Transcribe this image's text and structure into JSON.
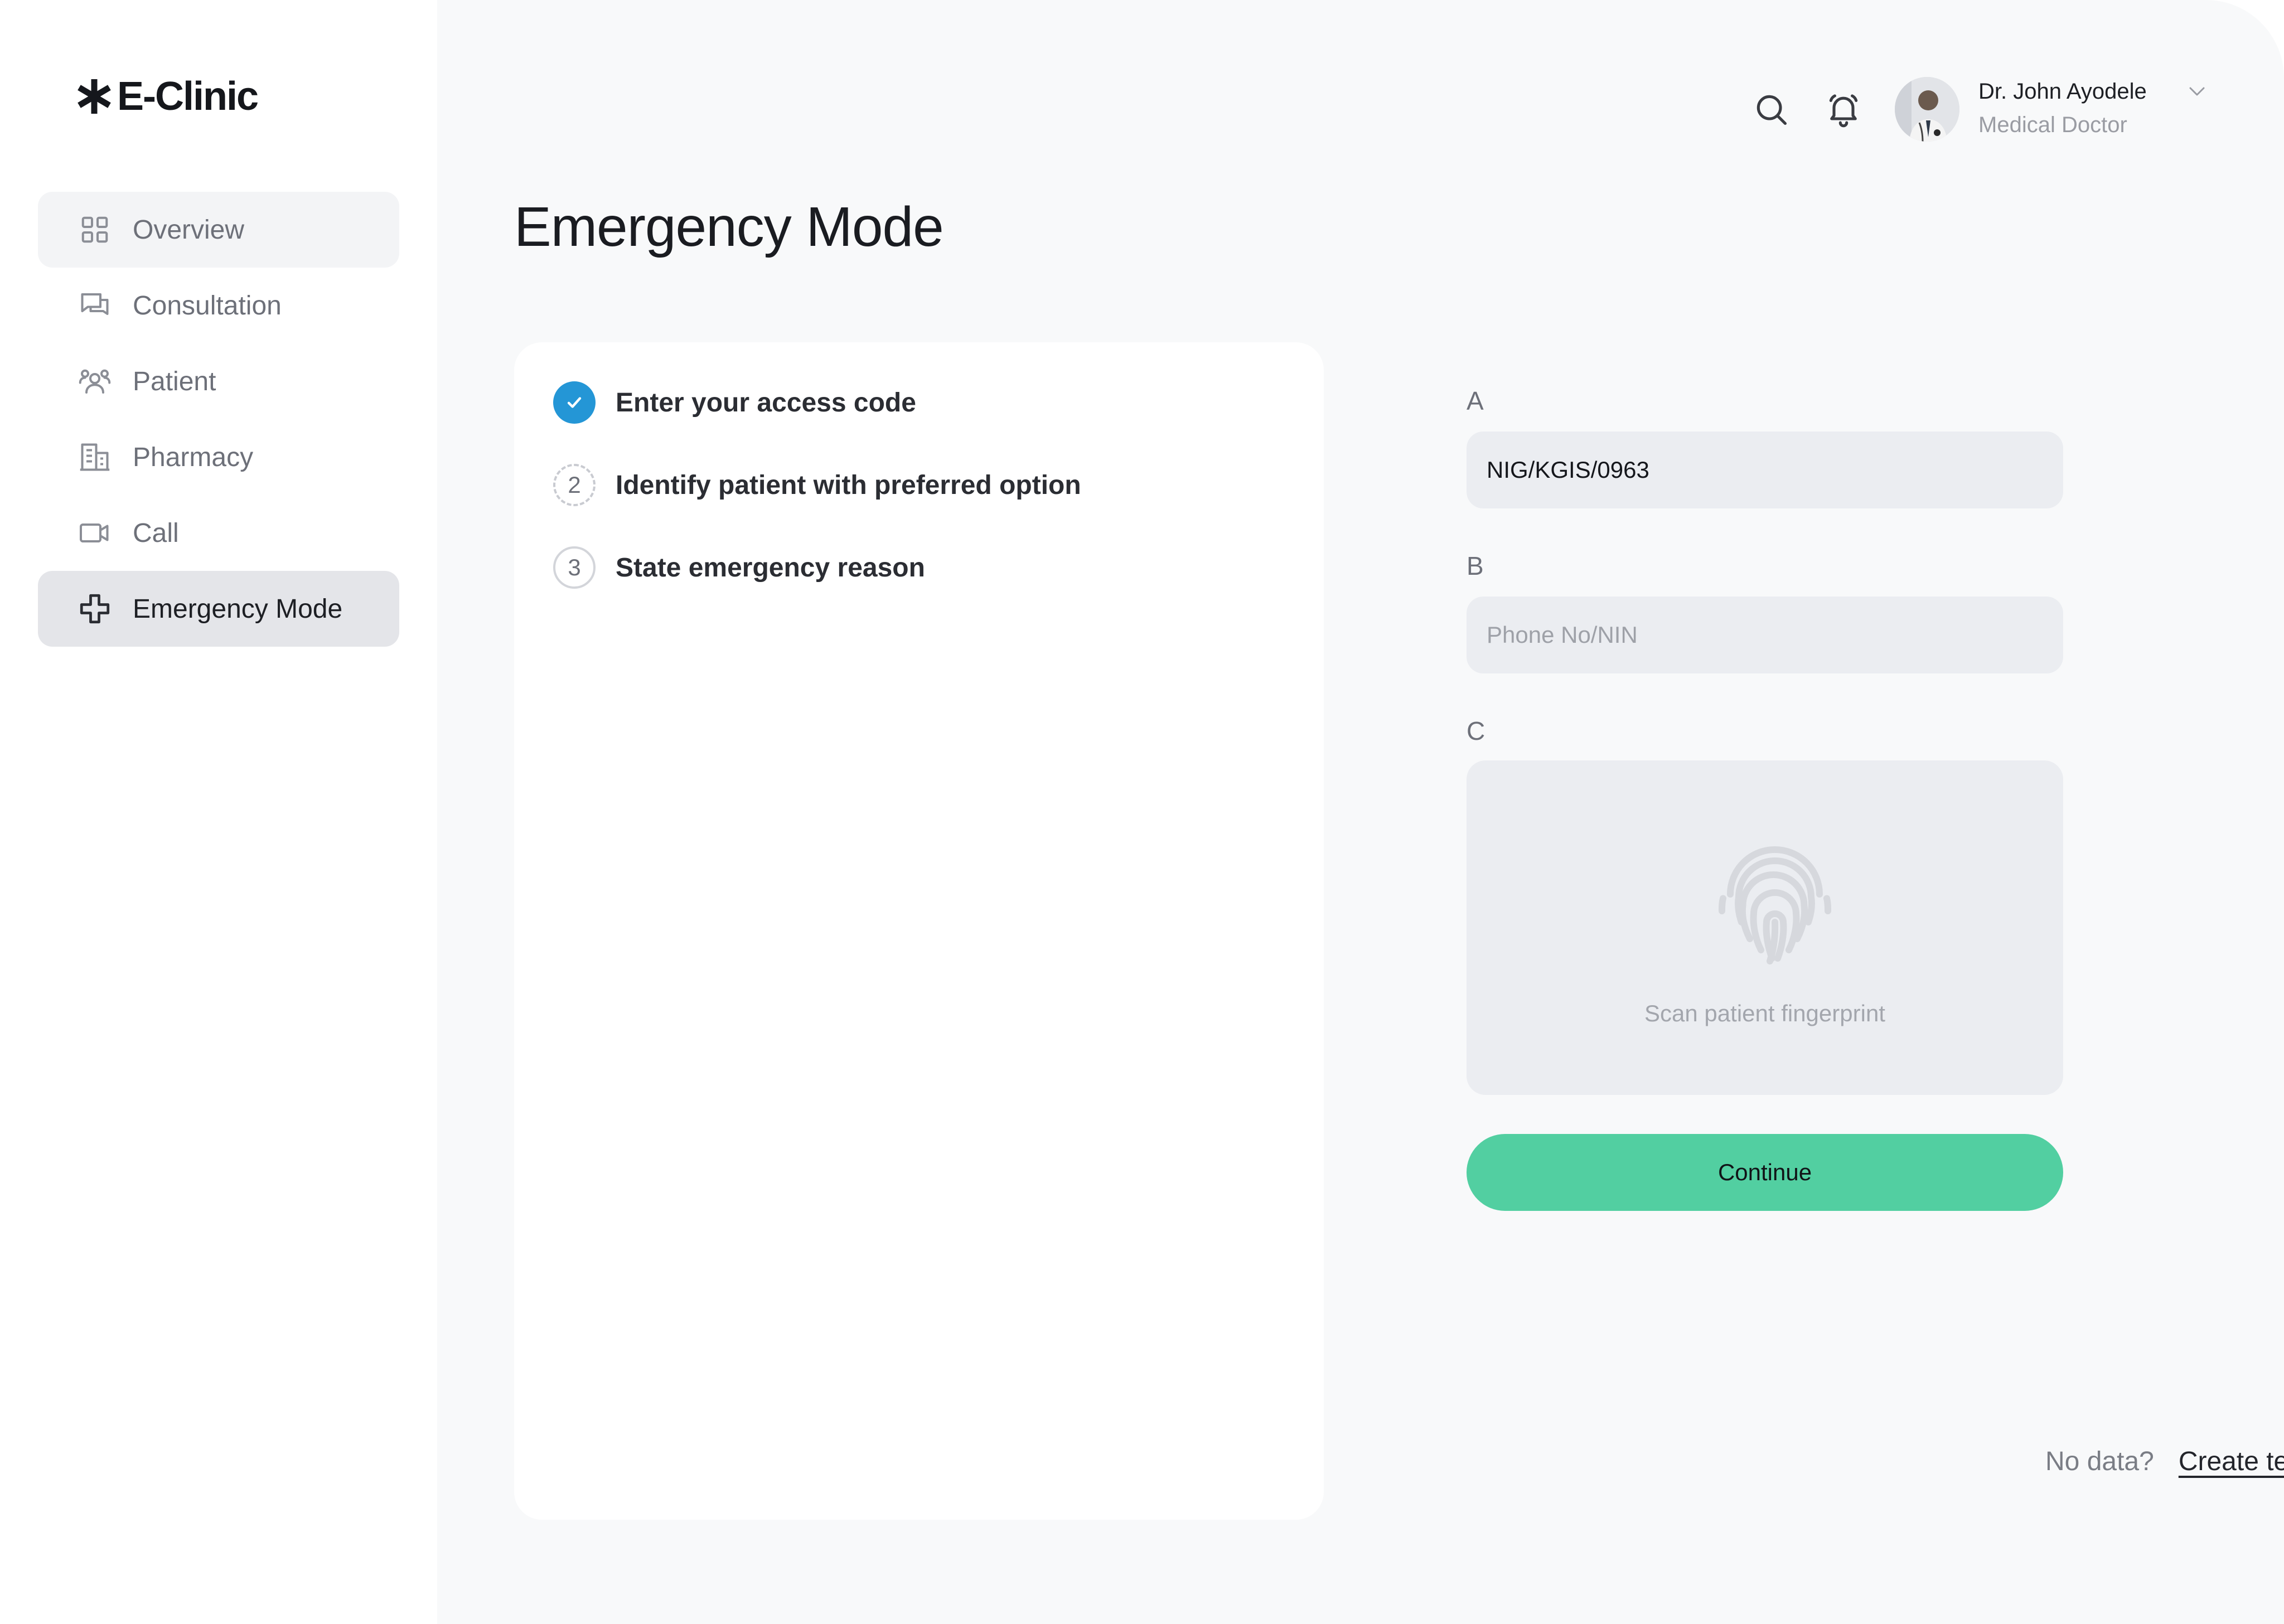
{
  "app": {
    "name": "E-Clinic"
  },
  "sidebar": {
    "items": [
      {
        "label": "Overview",
        "icon": "grid-icon",
        "state": "hover"
      },
      {
        "label": "Consultation",
        "icon": "chat-bubbles-icon",
        "state": "normal"
      },
      {
        "label": "Patient",
        "icon": "people-icon",
        "state": "normal"
      },
      {
        "label": "Pharmacy",
        "icon": "building-icon",
        "state": "normal"
      },
      {
        "label": "Call",
        "icon": "video-camera-icon",
        "state": "normal"
      },
      {
        "label": "Emergency Mode",
        "icon": "medical-cross-icon",
        "state": "active"
      }
    ]
  },
  "header": {
    "user": {
      "name": "Dr. John Ayodele",
      "role": "Medical Doctor"
    }
  },
  "page": {
    "title": "Emergency Mode"
  },
  "steps": [
    {
      "number": "",
      "label": "Enter your access code",
      "status": "done"
    },
    {
      "number": "2",
      "label": "Identify patient with preferred option",
      "status": "current"
    },
    {
      "number": "3",
      "label": "State emergency reason",
      "status": "todo"
    }
  ],
  "form": {
    "option_a": {
      "label": "A",
      "value": "NIG/KGIS/0963"
    },
    "option_b": {
      "label": "B",
      "value": "",
      "placeholder": "Phone No/NIN"
    },
    "option_c": {
      "label": "C",
      "scan_label": "Scan patient fingerprint"
    },
    "continue_label": "Continue"
  },
  "footer": {
    "prompt": "No data?",
    "link_label": "Create temporary profile"
  },
  "colors": {
    "accent_green": "#52cfa1",
    "step_done_blue": "#2496d6",
    "sidebar_active": "#e4e5e9",
    "main_bg": "#f8f9fa"
  }
}
